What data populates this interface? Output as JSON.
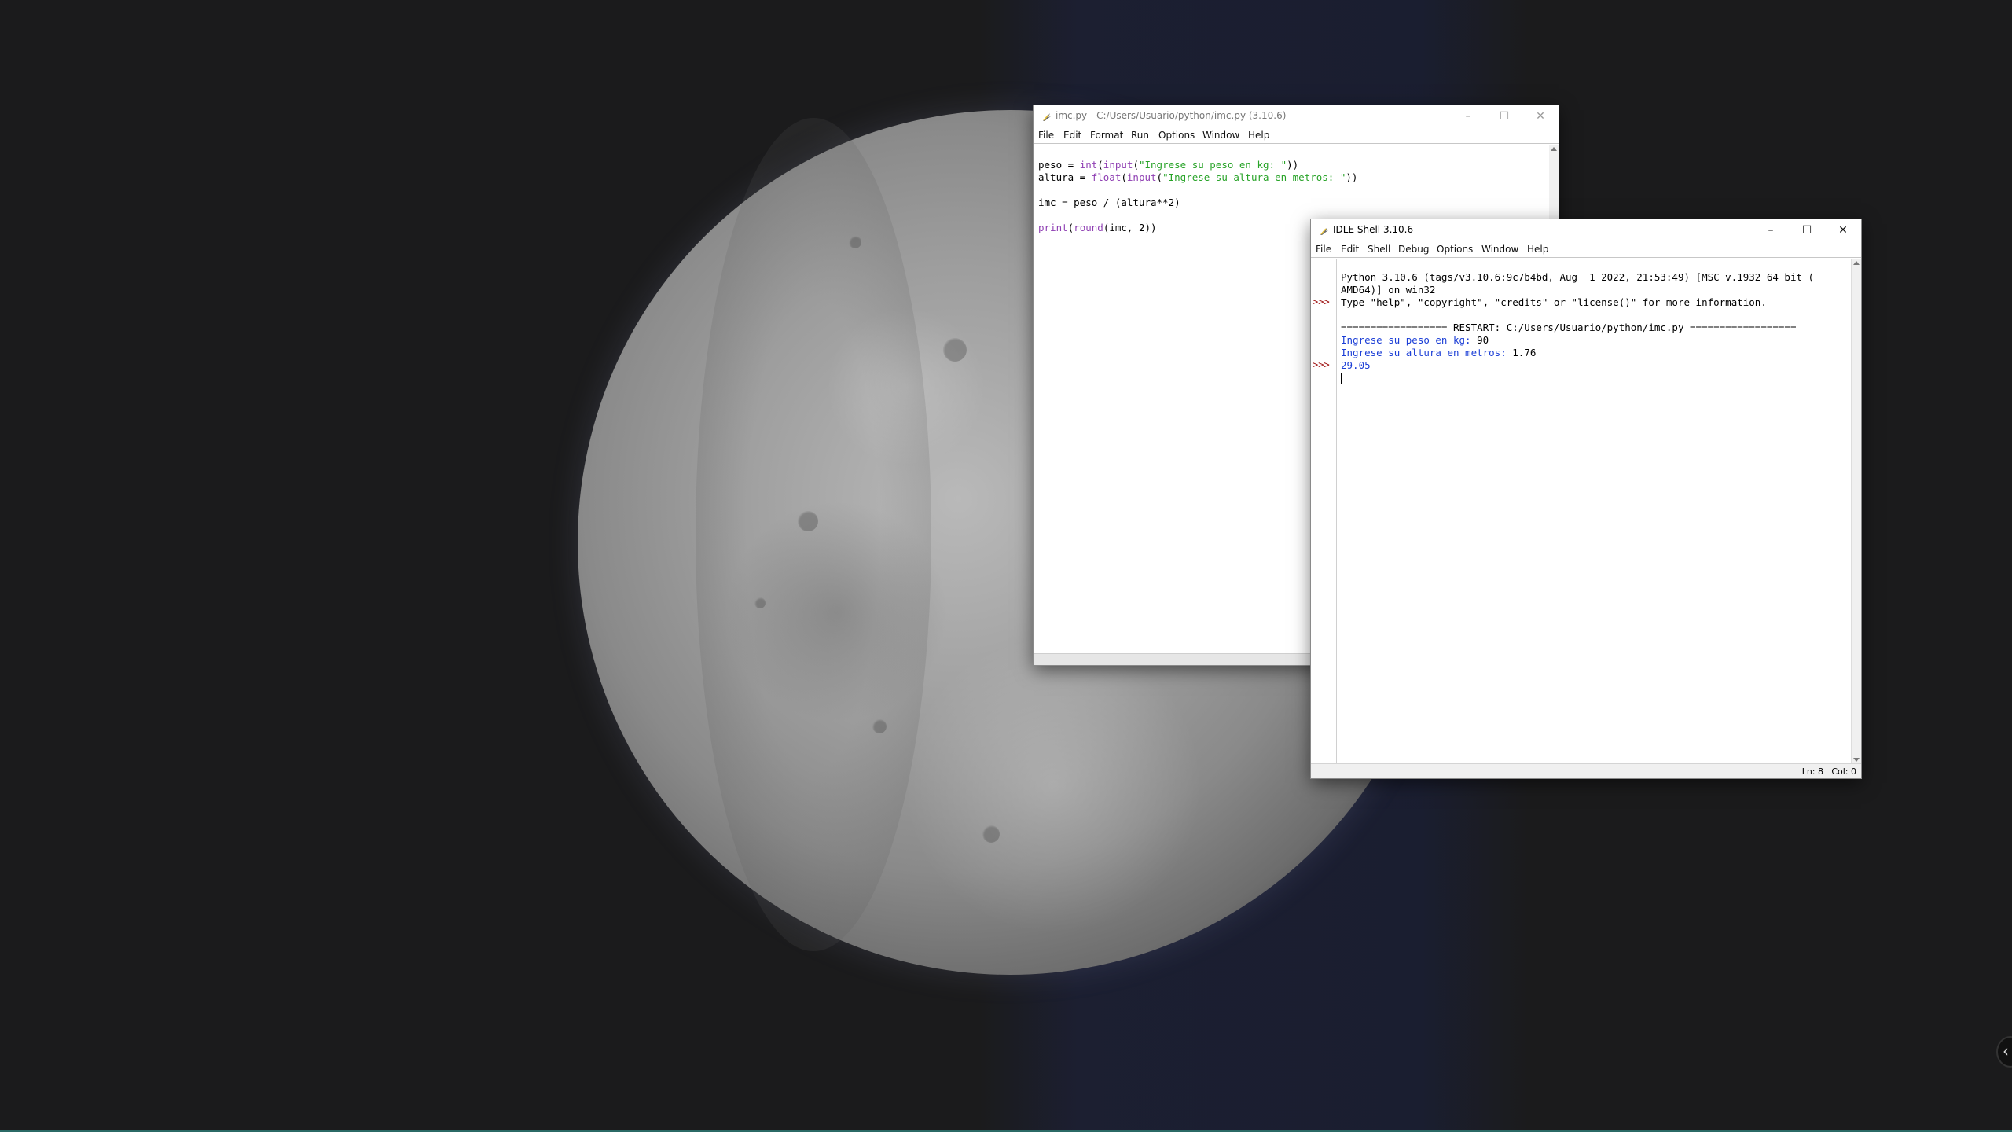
{
  "editor": {
    "title": "imc.py - C:/Users/Usuario/python/imc.py (3.10.6)",
    "menu": [
      "File",
      "Edit",
      "Format",
      "Run",
      "Options",
      "Window",
      "Help"
    ],
    "code": {
      "line1": {
        "a": "peso = ",
        "b": "int",
        "c": "(",
        "d": "input",
        "e": "(",
        "f": "\"Ingrese su peso en kg: \"",
        "g": "))"
      },
      "line2": {
        "a": "altura = ",
        "b": "float",
        "c": "(",
        "d": "input",
        "e": "(",
        "f": "\"Ingrese su altura en metros: \"",
        "g": "))"
      },
      "line4": "imc = peso / (altura**2)",
      "line6": {
        "a": "print",
        "b": "(",
        "c": "round",
        "d": "(imc, 2))"
      }
    }
  },
  "shell": {
    "title": "IDLE Shell 3.10.6",
    "menu": [
      "File",
      "Edit",
      "Shell",
      "Debug",
      "Options",
      "Window",
      "Help"
    ],
    "prompt": ">>>",
    "lines": {
      "banner1": "Python 3.10.6 (tags/v3.10.6:9c7b4bd, Aug  1 2022, 21:53:49) [MSC v.1932 64 bit (",
      "banner2": "AMD64)] on win32",
      "banner3": "Type \"help\", \"copyright\", \"credits\" or \"license()\" for more information.",
      "restart": "================== RESTART: C:/Users/Usuario/python/imc.py ==================",
      "q1": "Ingrese su peso en kg: ",
      "a1": "90",
      "q2": "Ingrese su altura en metros: ",
      "a2": "1.76",
      "result": "29.05"
    },
    "status": {
      "line": "Ln: 8",
      "col": "Col: 0"
    }
  },
  "window_controls": {
    "minimize": "–",
    "maximize": "☐",
    "close": "✕"
  },
  "colors": {
    "keyword": "#8f3fb3",
    "string": "#27a327",
    "output": "#1b3ed6",
    "prompt": "#a01515"
  }
}
